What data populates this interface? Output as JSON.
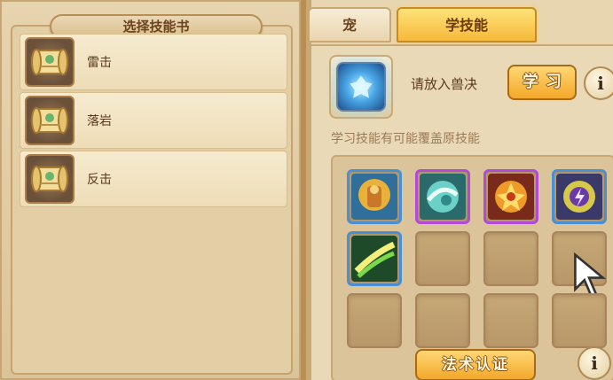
{
  "left_panel": {
    "title": "选择技能书",
    "items": [
      {
        "label": "雷击",
        "icon": "skill-book-scroll-icon"
      },
      {
        "label": "落岩",
        "icon": "skill-book-scroll-icon"
      },
      {
        "label": "反击",
        "icon": "skill-book-scroll-icon"
      }
    ]
  },
  "tabs": {
    "pet": "宠",
    "learn_skill": "学技能",
    "active": "learn_skill"
  },
  "learn_section": {
    "prompt": "请放入兽决",
    "learn_button": "学习",
    "warning": "学习技能有可能覆盖原技能",
    "info_icon": "info-icon"
  },
  "skill_grid": {
    "slots": [
      {
        "filled": true,
        "icon": "golden-idol-skill-icon"
      },
      {
        "filled": true,
        "icon": "wind-swirl-skill-icon"
      },
      {
        "filled": true,
        "icon": "fire-burst-skill-icon"
      },
      {
        "filled": true,
        "icon": "lightning-orb-skill-icon"
      },
      {
        "filled": true,
        "icon": "green-slash-skill-icon"
      },
      {
        "filled": false
      },
      {
        "filled": false
      },
      {
        "filled": false
      },
      {
        "filled": false
      },
      {
        "filled": false
      },
      {
        "filled": false
      },
      {
        "filled": false
      }
    ]
  },
  "bottom": {
    "spell_cert_button": "法术认证"
  },
  "colors": {
    "gold_button": "#f3a82a",
    "panel_bg": "#ead9b6",
    "text_brown": "#5a3a1e"
  }
}
